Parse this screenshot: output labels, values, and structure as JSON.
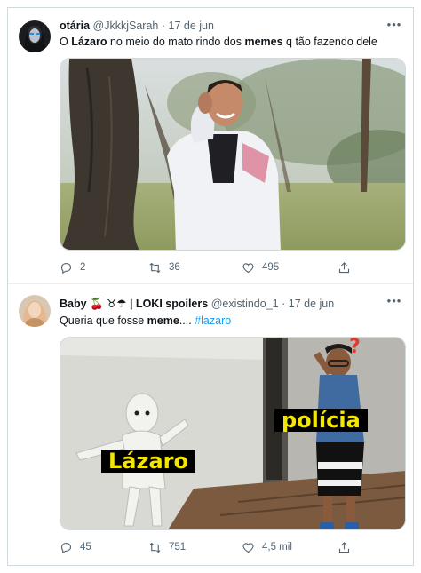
{
  "tweets": [
    {
      "author_name": "otária",
      "handle": "@JkkkjSarah",
      "separator": "·",
      "date": "17 de jun",
      "more_label": "•••",
      "text_parts": [
        "O ",
        "Lázaro",
        " no meio do mato rindo dos ",
        "memes",
        " q tão fazendo dele"
      ],
      "replies": "2",
      "retweets": "36",
      "likes": "495"
    },
    {
      "author_name": "Baby 🍒 ♉☂ | LOKI spoilers",
      "handle": "@existindo_1",
      "separator": "·",
      "date": "17 de jun",
      "more_label": "•••",
      "text_parts": [
        "Queria que fosse ",
        "meme",
        "....  ",
        "#lazaro"
      ],
      "replies": "45",
      "retweets": "751",
      "likes": "4,5 mil"
    }
  ],
  "meme": {
    "left_label": "Lázaro",
    "right_label": "polícia",
    "question_mark": "?"
  },
  "colors": {
    "text": "#0f1419",
    "secondary": "#536471",
    "link": "#1d9bf0",
    "meme_label_bg": "#000000",
    "meme_label_text": "#f3e600"
  }
}
